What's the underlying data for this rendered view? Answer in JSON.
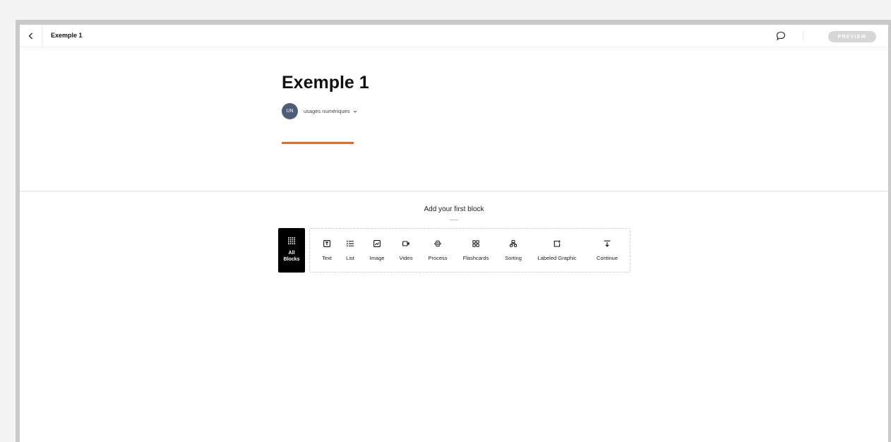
{
  "topbar": {
    "doc_title": "Exemple 1",
    "preview_label": "PREVIEW"
  },
  "header": {
    "title": "Exemple 1",
    "author": {
      "initials": "UN",
      "name": "usages numériques"
    }
  },
  "block_chooser": {
    "prompt": "Add your first block",
    "all_blocks_label": "All Blocks",
    "blocks": [
      {
        "label": "Text",
        "icon": "text-icon"
      },
      {
        "label": "List",
        "icon": "list-icon"
      },
      {
        "label": "Image",
        "icon": "image-icon"
      },
      {
        "label": "Video",
        "icon": "video-icon"
      },
      {
        "label": "Process",
        "icon": "process-icon"
      },
      {
        "label": "Flashcards",
        "icon": "flashcards-icon"
      },
      {
        "label": "Sorting",
        "icon": "sorting-icon"
      },
      {
        "label": "Labeled Graphic",
        "icon": "labeled-graphic-icon"
      },
      {
        "label": "Continue",
        "icon": "continue-icon"
      }
    ]
  },
  "colors": {
    "accent": "#f26522",
    "avatar": "#4d5e78",
    "preview_button": "#d6d6d6"
  }
}
